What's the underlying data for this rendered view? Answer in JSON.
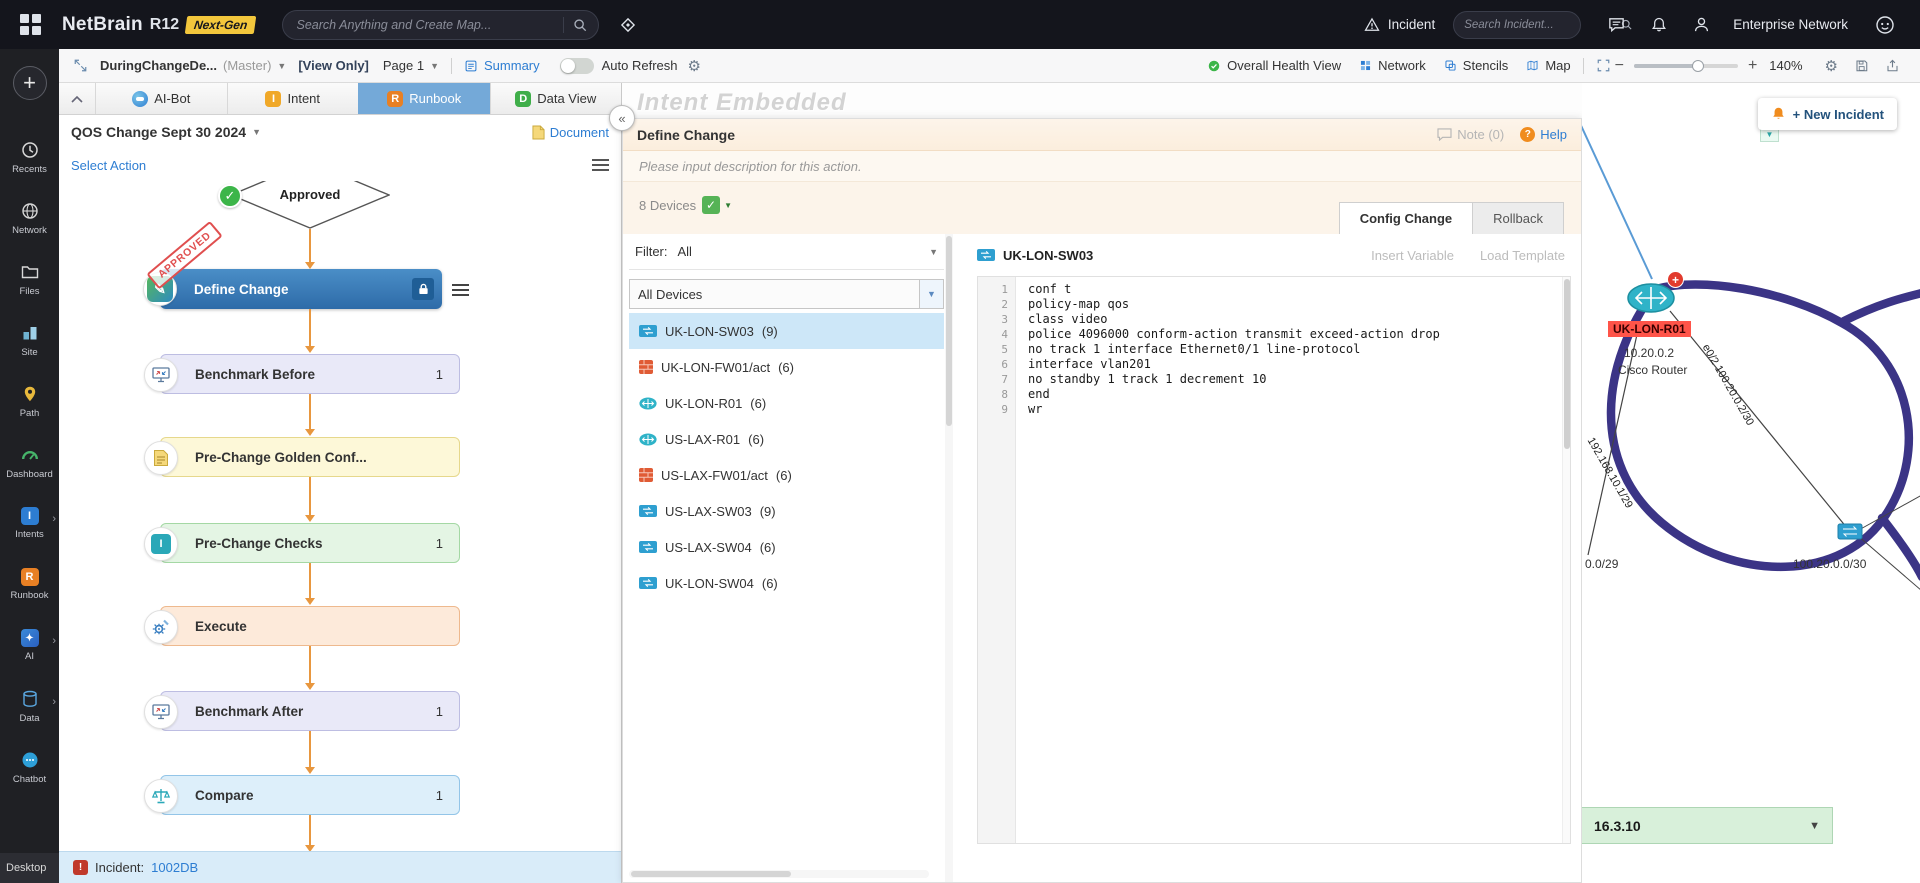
{
  "colors": {
    "accent_blue": "#2d7dd2",
    "brand_badge_yellow": "#f3c73c",
    "stamp_red": "#e04f4f",
    "selected_row_blue": "#cde7f8",
    "link_indigo": "#3b3486",
    "health_green": "#3cb549",
    "arrow_orange": "#e8973f"
  },
  "topbar": {
    "logo_name": "NetBrain",
    "logo_version": "R12",
    "logo_badge": "Next-Gen",
    "search_placeholder": "Search Anything and Create Map...",
    "incident_label": "Incident",
    "incident_search_placeholder": "Search Incident...",
    "tenant": "Enterprise Network"
  },
  "toolbar": {
    "map_name": "DuringChangeDe...",
    "map_suffix": "(Master)",
    "view_only": "[View Only]",
    "page": "Page 1",
    "summary": "Summary",
    "auto_refresh": "Auto Refresh",
    "overall_health": "Overall Health View",
    "network": "Network",
    "stencils": "Stencils",
    "map": "Map",
    "zoom_level": "140%"
  },
  "sidebar": {
    "items": [
      {
        "label": "Recents"
      },
      {
        "label": "Network"
      },
      {
        "label": "Files"
      },
      {
        "label": "Site"
      },
      {
        "label": "Path"
      },
      {
        "label": "Dashboard"
      },
      {
        "label": "Intents"
      },
      {
        "label": "Runbook"
      },
      {
        "label": "AI"
      },
      {
        "label": "Data"
      },
      {
        "label": "Chatbot"
      }
    ],
    "bottom_label": "Desktop"
  },
  "runbook": {
    "tabs": {
      "ai_bot": "AI-Bot",
      "intent": "Intent",
      "runbook": "Runbook",
      "data_view": "Data View"
    },
    "title": "QOS Change Sept 30 2024",
    "document_label": "Document",
    "select_action": "Select Action",
    "decision_label": "Approved",
    "stamp": "APPROVED",
    "nodes": [
      {
        "label": "Define Change",
        "count": ""
      },
      {
        "label": "Benchmark Before",
        "count": "1"
      },
      {
        "label": "Pre-Change Golden Conf...",
        "count": ""
      },
      {
        "label": "Pre-Change Checks",
        "count": "1"
      },
      {
        "label": "Execute",
        "count": ""
      },
      {
        "label": "Benchmark After",
        "count": "1"
      },
      {
        "label": "Compare",
        "count": "1"
      }
    ],
    "incident_label": "Incident:",
    "incident_id": "1002DB"
  },
  "dialog": {
    "watermark": "Intent Embedded",
    "title": "Define Change",
    "note": "Note (0)",
    "help": "Help",
    "description_placeholder": "Please input description for this action.",
    "devices_count": "8 Devices",
    "tab_config": "Config Change",
    "tab_rollback": "Rollback",
    "filter_label": "Filter:",
    "filter_value": "All",
    "device_group": "All Devices",
    "devices": [
      {
        "name": "UK-LON-SW03",
        "count": "(9)"
      },
      {
        "name": "UK-LON-FW01/act",
        "count": "(6)"
      },
      {
        "name": "UK-LON-R01",
        "count": "(6)"
      },
      {
        "name": "US-LAX-R01",
        "count": "(6)"
      },
      {
        "name": "US-LAX-FW01/act",
        "count": "(6)"
      },
      {
        "name": "US-LAX-SW03",
        "count": "(9)"
      },
      {
        "name": "US-LAX-SW04",
        "count": "(6)"
      },
      {
        "name": "UK-LON-SW04",
        "count": "(6)"
      }
    ],
    "editor": {
      "device": "UK-LON-SW03",
      "insert_variable": "Insert Variable",
      "load_template": "Load Template",
      "line_numbers": [
        "1",
        "2",
        "3",
        "4",
        "5",
        "6",
        "7",
        "8",
        "9"
      ],
      "lines": [
        "conf t",
        "policy-map qos",
        "class video",
        "police 4096000 conform-action transmit exceed-action drop",
        "no track 1 interface Ethernet0/1 line-protocol",
        "interface vlan201",
        "no standby 1 track 1 decrement 10",
        "end",
        "wr"
      ]
    }
  },
  "map": {
    "new_incident": "+ New Incident",
    "device_label": "UK-LON-R01",
    "device_ip": "10.20.0.2",
    "device_type": "Cisco Router",
    "link_label_1": "e0/2 100.20.0.2/30",
    "link_label_2": "192.168.10.1/29",
    "subnet_left": "0.0/29",
    "subnet_right": "100.20.0.0/30",
    "green_node_ip": "16.3.10"
  }
}
